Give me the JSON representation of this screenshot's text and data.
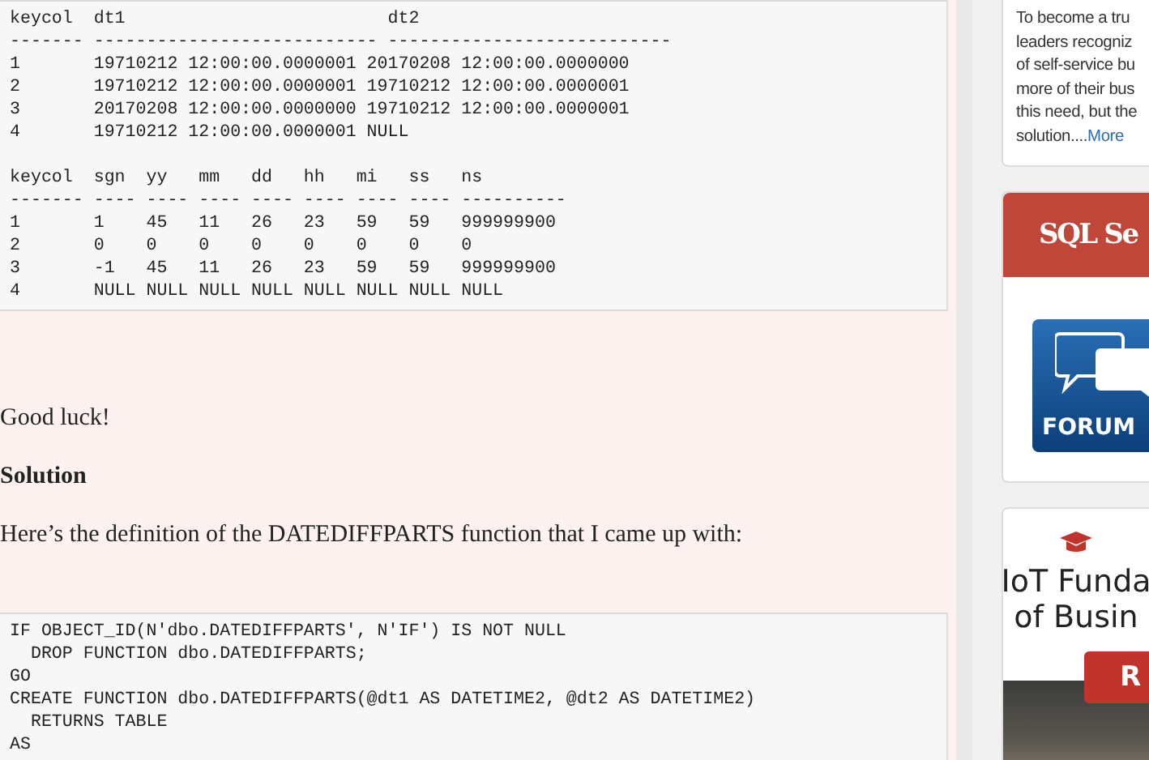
{
  "article": {
    "code_blocks_before": [
      {
        "sections": [
          [
            "keycol  dt1                         dt2",
            "------- --------------------------- ---------------------------",
            "1       19710212 12:00:00.0000001 20170208 12:00:00.0000000",
            "2       19710212 12:00:00.0000001 19710212 12:00:00.0000001",
            "3       20170208 12:00:00.0000000 19710212 12:00:00.0000001",
            "4       19710212 12:00:00.0000001 NULL"
          ],
          [
            "keycol  sgn  yy   mm   dd   hh   mi   ss   ns",
            "------- ---- ---- ---- ---- ---- ---- ---- ----------",
            "1       1    45   11   26   23   59   59   999999900",
            "2       0    0    0    0    0    0    0    0",
            "3       -1   45   11   26   23   59   59   999999900",
            "4       NULL NULL NULL NULL NULL NULL NULL NULL"
          ]
        ]
      }
    ],
    "paragraphs": [
      {
        "kind": "text",
        "text": "Good luck!"
      },
      {
        "kind": "heading",
        "text": "Solution"
      },
      {
        "kind": "text",
        "text": "Here’s the definition of the DATEDIFFPARTS function that I came up with:"
      }
    ],
    "code_blocks_after": [
      {
        "sections": [
          [
            "IF OBJECT_ID(N'dbo.DATEDIFFPARTS', N'IF') IS NOT NULL",
            "  DROP FUNCTION dbo.DATEDIFFPARTS;",
            "GO",
            "CREATE FUNCTION dbo.DATEDIFFPARTS(@dt1 AS DATETIME2, @dt2 AS DATETIME2)",
            "  RETURNS TABLE",
            "AS"
          ]
        ]
      }
    ]
  },
  "sidebar": {
    "promo_text": {
      "lines": [
        "To become a tru",
        "leaders recogniz",
        "of self-service bu",
        "more of their bus",
        "this need, but the"
      ],
      "last_line": "solution....",
      "link": "More"
    },
    "forum_banner": {
      "title": "SQL Se",
      "image_label": "FORUM"
    },
    "course_ad": {
      "title_lines": [
        "IoT Funda",
        "of Busin"
      ],
      "button": "R"
    }
  }
}
